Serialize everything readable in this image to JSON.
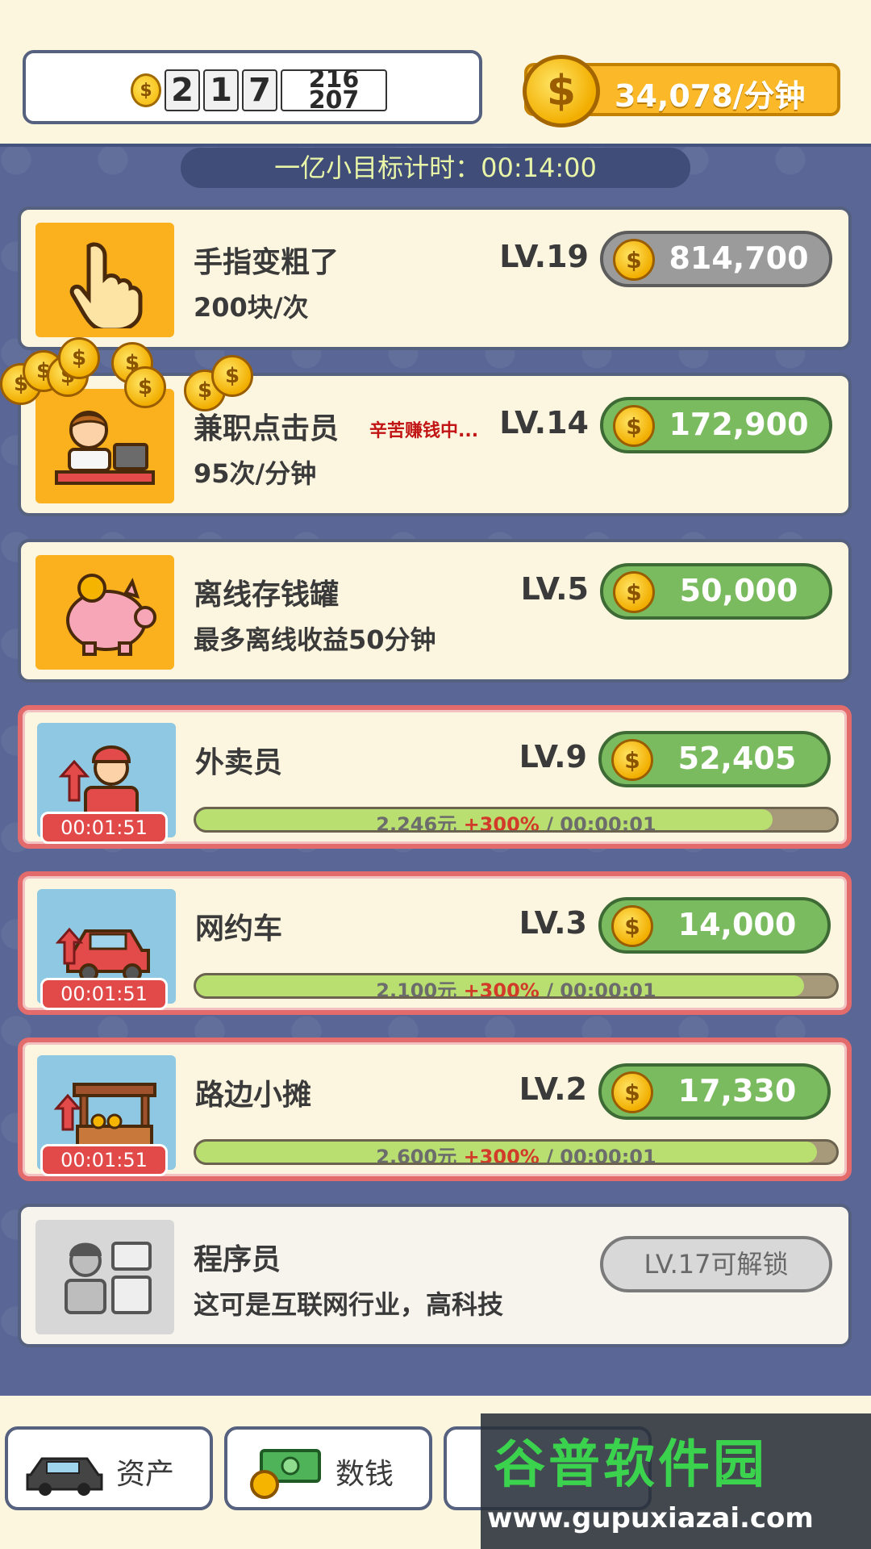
{
  "header": {
    "coin_symbol": "$",
    "counter_digits": [
      "2",
      "1",
      "7"
    ],
    "rolling_digits_top": "216",
    "rolling_digits_bottom": "207",
    "rate_text": "34,078/分钟"
  },
  "goal_timer": {
    "text": "一亿小目标计时：00:14:00"
  },
  "cards": [
    {
      "title": "手指变粗了",
      "subtitle": "200块/次",
      "level": "LV.19",
      "price": "814,700",
      "price_state": "disabled"
    },
    {
      "title": "兼职点击员",
      "subtitle": "95次/分钟",
      "level": "LV.14",
      "price": "172,900",
      "price_state": "enabled",
      "status": "辛苦赚钱中..."
    },
    {
      "title": "离线存钱罐",
      "subtitle": "最多离线收益50分钟",
      "level": "LV.5",
      "price": "50,000",
      "price_state": "enabled"
    },
    {
      "title": "外卖员",
      "level": "LV.9",
      "price": "52,405",
      "timer": "00:01:51",
      "income": "2,246元",
      "boost": "+300%",
      "cycle": "/ 00:00:01",
      "progress": 0.9
    },
    {
      "title": "网约车",
      "level": "LV.3",
      "price": "14,000",
      "timer": "00:01:51",
      "income": "2,100元",
      "boost": "+300%",
      "cycle": "/ 00:00:01",
      "progress": 0.95
    },
    {
      "title": "路边小摊",
      "level": "LV.2",
      "price": "17,330",
      "timer": "00:01:51",
      "income": "2,600元",
      "boost": "+300%",
      "cycle": "/ 00:00:01",
      "progress": 0.97
    },
    {
      "title": "程序员",
      "subtitle": "这可是互联网行业，高科技",
      "unlock": "LV.17可解锁"
    }
  ],
  "bottom_nav": [
    {
      "label": "资产"
    },
    {
      "label": "数钱"
    }
  ],
  "watermark": {
    "title": "谷普软件园",
    "url": "www.gupuxiazai.com"
  },
  "colors": {
    "accent": "#fbb92a",
    "buy_green": "#7bbb5f",
    "alert_red": "#e24a4a",
    "panel_bg": "#5a6796"
  }
}
